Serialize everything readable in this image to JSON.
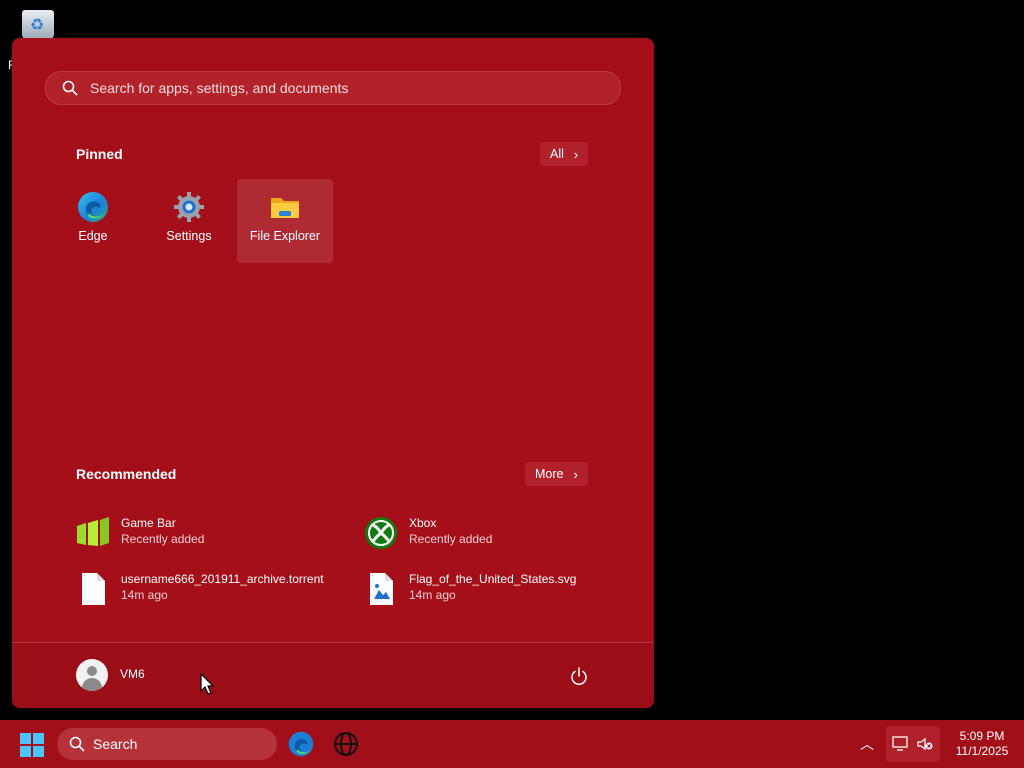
{
  "desktop": {
    "recycle_label": "R"
  },
  "start": {
    "search_placeholder": "Search for apps, settings, and documents",
    "pinned_title": "Pinned",
    "all_label": "All",
    "pinned": [
      {
        "label": "Edge",
        "icon": "edge-icon"
      },
      {
        "label": "Settings",
        "icon": "settings-gear-icon"
      },
      {
        "label": "File Explorer",
        "icon": "folder-icon"
      }
    ],
    "recommended_title": "Recommended",
    "more_label": "More",
    "recommended": [
      {
        "name": "Game Bar",
        "sub": "Recently added",
        "icon": "game-bar-icon"
      },
      {
        "name": "Xbox",
        "sub": "Recently added",
        "icon": "xbox-icon"
      },
      {
        "name": "username666_201911_archive.torrent",
        "sub": "14m ago",
        "icon": "file-icon"
      },
      {
        "name": "Flag_of_the_United_States.svg",
        "sub": "14m ago",
        "icon": "image-file-icon"
      }
    ],
    "user": "VM6"
  },
  "taskbar": {
    "search_placeholder": "Search",
    "time": "5:09 PM",
    "date": "11/1/2025"
  },
  "colors": {
    "accent": "#a50f1a",
    "taskbar": "#a10f19"
  }
}
